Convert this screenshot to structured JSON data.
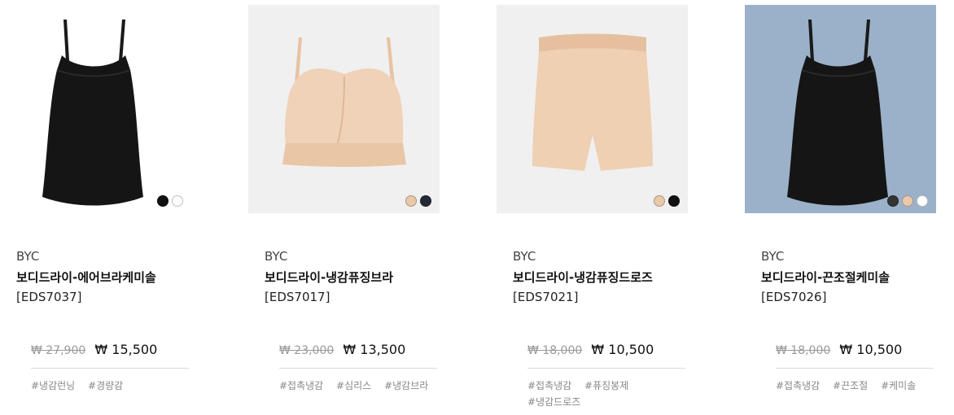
{
  "products": [
    {
      "brand": "BYC",
      "name": "보디드라이-에어브라케미솔",
      "code": "[EDS7037]",
      "old_price": "₩ 27,900",
      "price": "₩ 15,500",
      "tags": [
        "#냉감런닝",
        "#경량감"
      ],
      "image_bg": "#ffffff",
      "image_kind": "camisole-black",
      "swatches": [
        "#111111",
        "#ffffff"
      ]
    },
    {
      "brand": "BYC",
      "name": "보디드라이-냉감퓨징브라",
      "code": "[EDS7017]",
      "old_price": "₩ 23,000",
      "price": "₩ 13,500",
      "tags": [
        "#접촉냉감",
        "#심리스",
        "#냉감브라"
      ],
      "image_bg": "#f0f0f0",
      "image_kind": "bra-beige",
      "swatches": [
        "#e9c9ab",
        "#232a36"
      ]
    },
    {
      "brand": "BYC",
      "name": "보디드라이-냉감퓨징드로즈",
      "code": "[EDS7021]",
      "old_price": "₩ 18,000",
      "price": "₩ 10,500",
      "tags": [
        "#접촉냉감",
        "#퓨징봉제",
        "#냉감드로즈"
      ],
      "image_bg": "#f0f0f0",
      "image_kind": "shorts-beige",
      "swatches": [
        "#e9c9ab",
        "#111111"
      ]
    },
    {
      "brand": "BYC",
      "name": "보디드라이-끈조절케미솔",
      "code": "[EDS7026]",
      "old_price": "₩ 18,000",
      "price": "₩ 10,500",
      "tags": [
        "#접촉냉감",
        "#끈조절",
        "#케미솔"
      ],
      "image_bg": "#9ab1c9",
      "image_kind": "camisole-black",
      "swatches": [
        "#333333",
        "#e9c9ab",
        "#ffffff"
      ]
    }
  ]
}
